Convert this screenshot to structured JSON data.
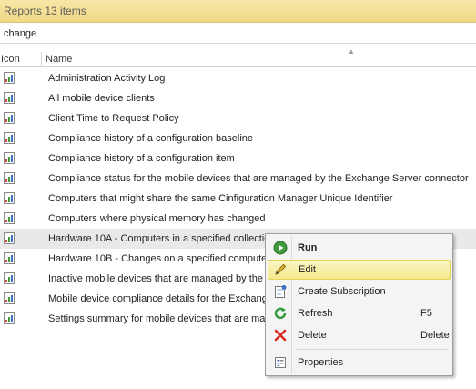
{
  "header": {
    "title": "Reports 13 items"
  },
  "search": {
    "value": "change"
  },
  "columns": {
    "icon": "Icon",
    "name": "Name"
  },
  "rows": [
    {
      "label": "Administration Activity Log"
    },
    {
      "label": "All mobile device clients"
    },
    {
      "label": "Client Time to Request Policy"
    },
    {
      "label": "Compliance history of a configuration baseline"
    },
    {
      "label": "Compliance history of a configuration item"
    },
    {
      "label": "Compliance status for the mobile devices that are managed by the Exchange Server connector"
    },
    {
      "label": "Computers that might share the same Cinfiguration Manager Unique Identifier"
    },
    {
      "label": "Computers where physical memory has changed"
    },
    {
      "label": "Hardware 10A - Computers in a specified collectio"
    },
    {
      "label": "Hardware 10B - Changes on a specified compute"
    },
    {
      "label": "Inactive mobile devices that are managed by the"
    },
    {
      "label": "Mobile device compliance details for the Exchang"
    },
    {
      "label": "Settings summary for mobile devices that are ma"
    }
  ],
  "context_menu": {
    "items": [
      {
        "label": "Run",
        "icon": "run-icon",
        "shortcut": ""
      },
      {
        "label": "Edit",
        "icon": "pencil-icon",
        "shortcut": ""
      },
      {
        "label": "Create Subscription",
        "icon": "subscription-icon",
        "shortcut": ""
      },
      {
        "label": "Refresh",
        "icon": "refresh-icon",
        "shortcut": "F5"
      },
      {
        "label": "Delete",
        "icon": "delete-icon",
        "shortcut": "Delete"
      },
      {
        "label": "Properties",
        "icon": "properties-icon",
        "shortcut": ""
      }
    ]
  },
  "colors": {
    "header_bg": "#f0d884",
    "header_text": "#5a5a5a",
    "selected_row": "#e9e9e9",
    "menu_highlight": "#f3e98a"
  }
}
